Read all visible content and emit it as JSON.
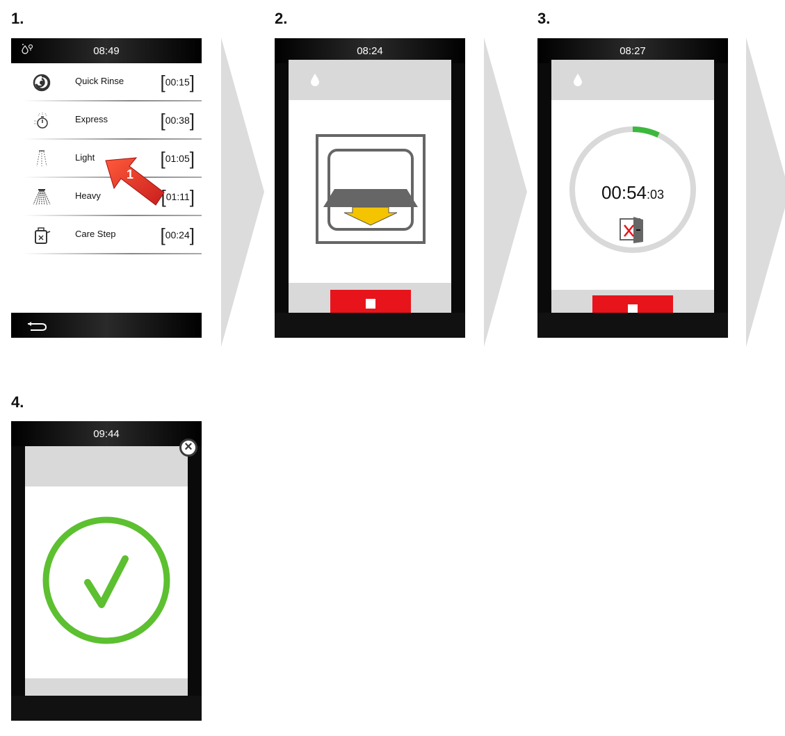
{
  "steps": [
    {
      "number": "1."
    },
    {
      "number": "2."
    },
    {
      "number": "3."
    },
    {
      "number": "4."
    }
  ],
  "screen1": {
    "time": "08:49",
    "programs": [
      {
        "label": "Quick Rinse",
        "duration": "00:15",
        "icon": "spiral-icon"
      },
      {
        "label": "Express",
        "duration": "00:38",
        "icon": "stopwatch-spray-icon"
      },
      {
        "label": "Light",
        "duration": "01:05",
        "icon": "light-spray-icon"
      },
      {
        "label": "Heavy",
        "duration": "01:11",
        "icon": "heavy-spray-icon"
      },
      {
        "label": "Care Step",
        "duration": "00:24",
        "icon": "care-bottle-icon"
      }
    ],
    "callout": "1",
    "back_icon": "back-arrow-icon"
  },
  "screen2": {
    "time": "08:24",
    "icon": "close-door-icon"
  },
  "screen3": {
    "time": "08:27",
    "timer_main": "00:54",
    "timer_sec": ":03",
    "progress_fraction": 0.07,
    "icon": "door-locked-icon"
  },
  "screen4": {
    "time": "09:44",
    "icon": "success-check-icon"
  },
  "colors": {
    "stop": "#e8141c",
    "progress": "#3cb83c",
    "check": "#5cc030",
    "arrow": "#e8332a",
    "tray_arrow": "#f5c400"
  }
}
